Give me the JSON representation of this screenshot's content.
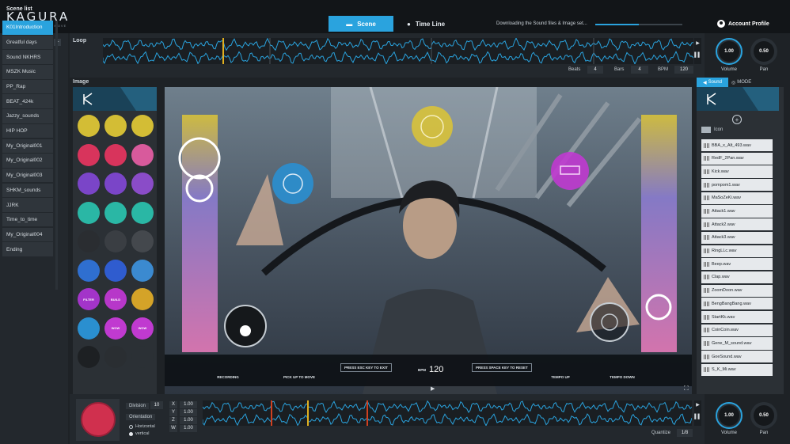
{
  "app": {
    "logo": "KAGURA",
    "logo_sub": "MAKE THE MUSIC MOVE"
  },
  "tabs": [
    {
      "label": "Scene",
      "icon": "chat-icon",
      "active": true
    },
    {
      "label": "Time Line",
      "icon": "clock-icon",
      "active": false
    }
  ],
  "download": {
    "text": "Downloading the Sound files & Image set...",
    "progress": 0.5
  },
  "account": {
    "label": "Account Profile"
  },
  "colors": {
    "accent": "#2aa3de",
    "panel": "#23282d",
    "track_wave": "#2aa3de",
    "pink": "#e47ab8",
    "yellow": "#d8c23a"
  },
  "scene_list": {
    "title": "Scene list",
    "items": [
      "K01Introduction",
      "Greatful days",
      "Sound NKHRS",
      "MSZK Music",
      "PP_Rap",
      "BEAT_424k",
      "Jazzy_sounds",
      "HIP HOP",
      "My_Original001",
      "My_Original002",
      "My_Original003",
      "SHKM_sounds",
      "JJRK",
      "Time_to_time",
      "My_Original004",
      "Ending"
    ],
    "active_index": 0
  },
  "loop": {
    "label": "Loop",
    "beats_label": "Beats",
    "beats": "4",
    "bars_label": "Bars",
    "bars": "4",
    "bpm_label": "BPM",
    "bpm": "120"
  },
  "knobs_top": {
    "volume_value": "1.00",
    "volume_label": "Volume",
    "pan_value": "0.50",
    "pan_label": "Pan"
  },
  "image": {
    "label": "Image",
    "palette": [
      [
        "#d3bd35",
        "#d3bd35",
        "#d3bd35"
      ],
      [
        "#d8345c",
        "#d8345c",
        "#d85a9c"
      ],
      [
        "#7a45c8",
        "#7a45c8",
        "#8a4cc8"
      ],
      [
        "#2ab7a5",
        "#2ab7a5",
        "#2ab7a5"
      ],
      [
        "#2a2d31",
        "#3a3e43",
        "#44484d"
      ],
      [
        "#2f6fd0",
        "#2f5ccf",
        "#3b8ad0"
      ],
      [
        "#a334c9",
        "#b737c9",
        "#d4a328"
      ],
      [
        "#2a8fd0",
        "#c03ad0",
        "#c03ad0"
      ],
      [
        "#1d2023",
        "#2a2e32",
        "#2b3035"
      ]
    ],
    "palette_icons": [
      [
        "",
        "",
        ""
      ],
      [
        "",
        "",
        ""
      ],
      [
        "",
        "",
        ""
      ],
      [
        "",
        "",
        ""
      ],
      [
        "",
        "",
        ""
      ],
      [
        "",
        "",
        ""
      ],
      [
        "FILTER",
        "BUILD",
        ""
      ],
      [
        "",
        "WOW",
        "WOW"
      ],
      [
        "",
        "",
        ""
      ]
    ]
  },
  "stage": {
    "controls": {
      "recording": "RECORDING",
      "pick_up": "PICK UP TO MOVE",
      "esc": "PRESS ESC KEY TO EXIT",
      "bpm_label": "BPM",
      "bpm_value": "120",
      "space": "PRESS SPACE KEY TO RESET",
      "tempo_up": "TEMPO UP",
      "tempo_down": "TEMPO DOWN"
    }
  },
  "sound_panel": {
    "tab_sound": "Sound",
    "tab_mode": "MODE",
    "folder": "Icon",
    "items": [
      "BBA_x_Alt_493.wav",
      "RedF_2Pan.wav",
      "Kick.wav",
      "pompom1.wav",
      "MaSoZeKi.wav",
      "Attack1.wav",
      "Attack2.wav",
      "Attack3.wav",
      "RingLLc.wav",
      "Beep.wav",
      "Clap.wav",
      "ZoomDoon.wav",
      "BengBangBang.wav",
      "StartKk.wav",
      "CoinCoin.wav",
      "Gene_M_sound.wav",
      "GoeSound.wav",
      "S_K_Mi.wav"
    ]
  },
  "bottom": {
    "division_label": "Division",
    "division": "10",
    "orientation_label": "Orientation",
    "orient_h": "Horizontal",
    "orient_v": "vertical",
    "axes": [
      {
        "name": "X",
        "value": "1.00"
      },
      {
        "name": "Y",
        "value": "1.00"
      },
      {
        "name": "Z",
        "value": "1.00"
      },
      {
        "name": "W",
        "value": "1.00"
      }
    ],
    "quantize_label": "Quantize",
    "quantize": "1/8",
    "volume_value": "1.00",
    "volume_label": "Volume",
    "pan_value": "0.50",
    "pan_label": "Pan"
  }
}
